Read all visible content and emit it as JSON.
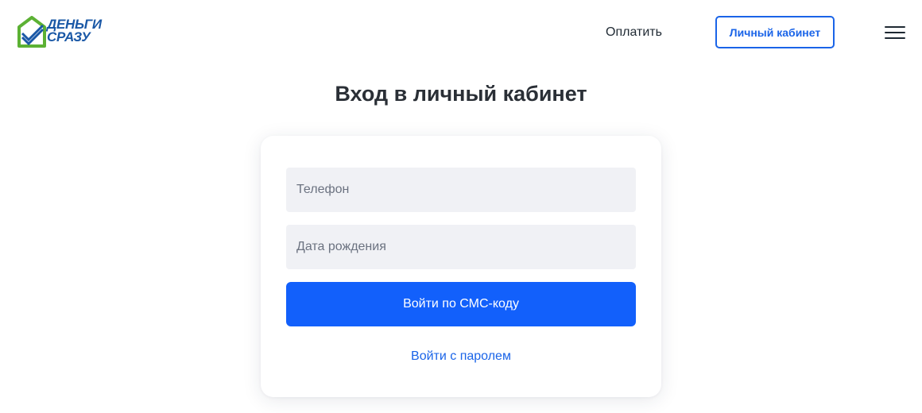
{
  "header": {
    "logo": {
      "line1": "ДЕНЬГИ",
      "line2": "СРАЗУ",
      "icon": "logo-shield-check-icon",
      "colors": {
        "green": "#5cb134",
        "blue": "#1a58a6"
      }
    },
    "nav_pay_label": "Оплатить",
    "cabinet_button_label": "Личный кабинет",
    "menu_icon": "hamburger-menu-icon"
  },
  "main": {
    "title": "Вход в личный кабинет",
    "form": {
      "phone": {
        "value": "",
        "placeholder": "Телефон"
      },
      "birth_date": {
        "value": "",
        "placeholder": "Дата рождения"
      },
      "sms_button_label": "Войти по СМС-коду",
      "password_link_label": "Войти с паролем"
    }
  },
  "colors": {
    "accent": "#1260fb",
    "link": "#1a64e8",
    "field_bg": "#f0f1f5",
    "text": "#1f2933"
  }
}
